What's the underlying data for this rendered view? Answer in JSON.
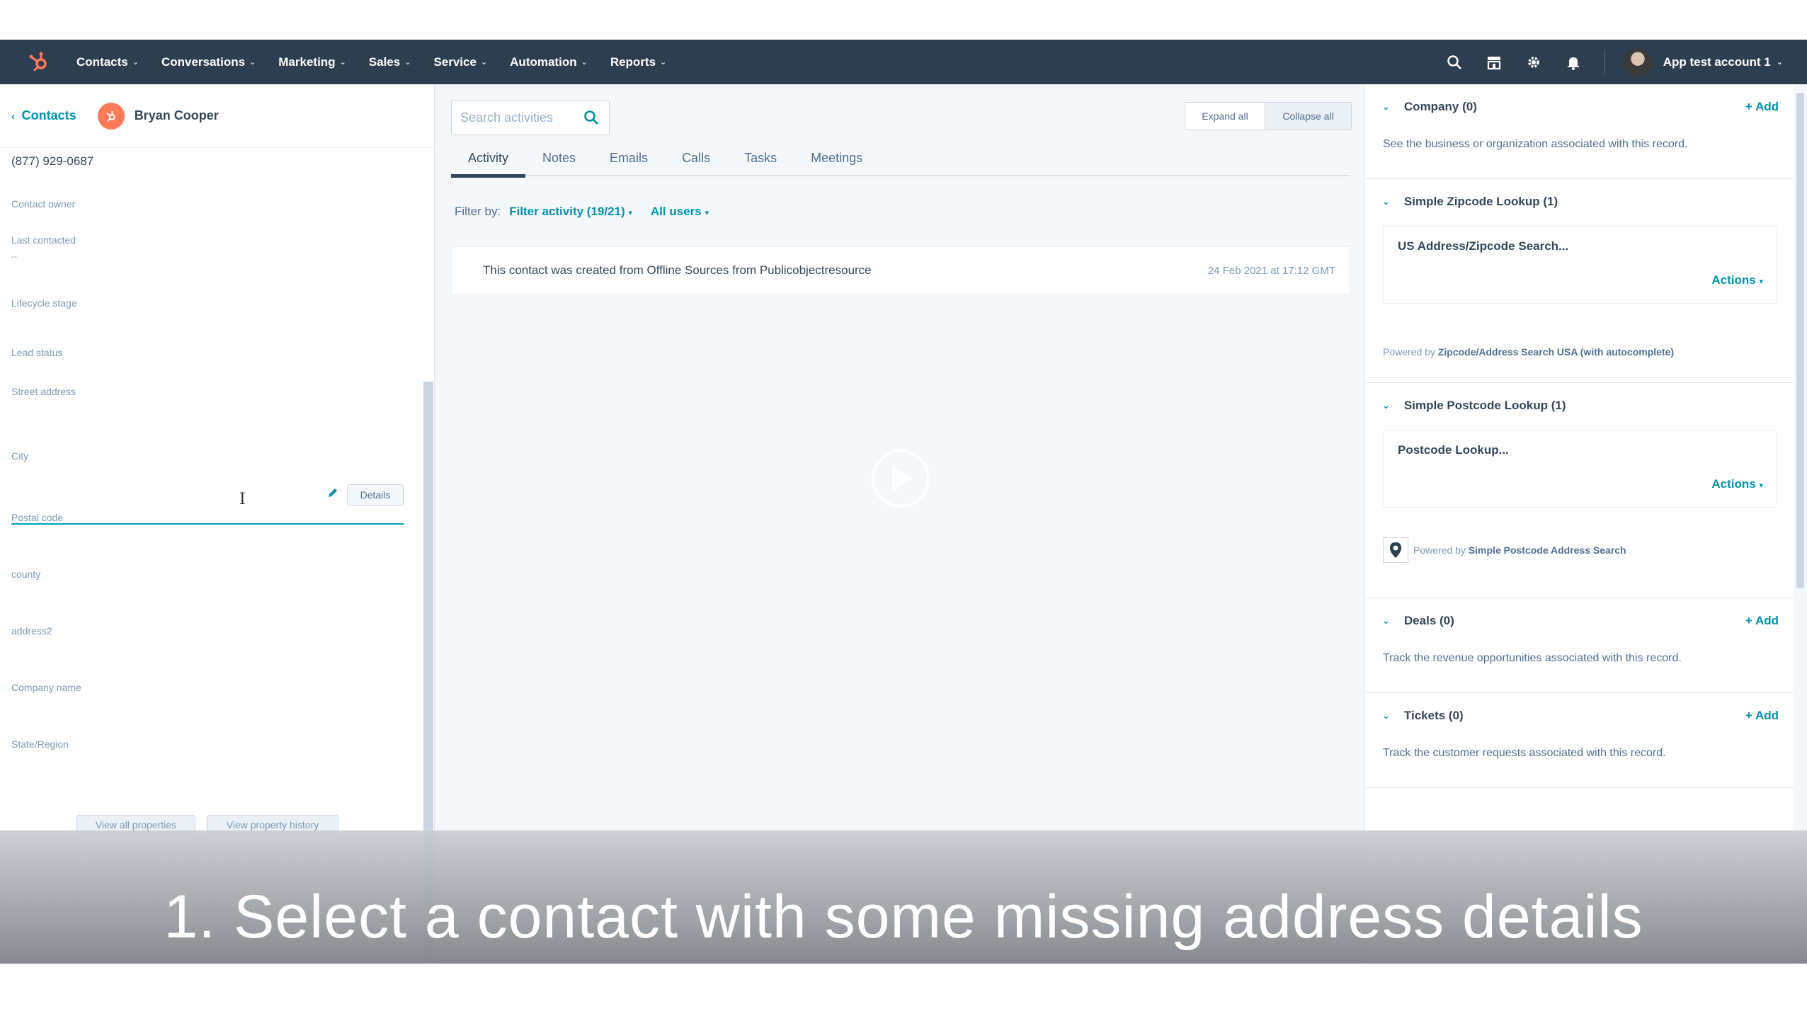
{
  "nav": {
    "items": [
      {
        "label": "Contacts"
      },
      {
        "label": "Conversations"
      },
      {
        "label": "Marketing"
      },
      {
        "label": "Sales"
      },
      {
        "label": "Service"
      },
      {
        "label": "Automation"
      },
      {
        "label": "Reports"
      }
    ],
    "account_label": "App test account 1",
    "icons": [
      "search-icon",
      "marketplace-icon",
      "gear-icon",
      "bell-icon"
    ]
  },
  "left": {
    "back_label": "Contacts",
    "contact_name": "Bryan Cooper",
    "phone": "(877) 929-0687",
    "properties": [
      {
        "label": "Contact owner"
      },
      {
        "label": "Last contacted",
        "value": "--"
      },
      {
        "label": "Lifecycle stage"
      },
      {
        "label": "Lead status"
      },
      {
        "label": "Street address"
      },
      {
        "label": "City"
      },
      {
        "label": "Postal code"
      },
      {
        "label": "county"
      },
      {
        "label": "address2"
      },
      {
        "label": "Company name"
      },
      {
        "label": "State/Region"
      }
    ],
    "details_label": "Details",
    "view_all_label": "View all properties",
    "view_history_label": "View property history"
  },
  "middle": {
    "search_placeholder": "Search activities",
    "expand_all": "Expand all",
    "collapse_all": "Collapse all",
    "tabs": [
      "Activity",
      "Notes",
      "Emails",
      "Calls",
      "Tasks",
      "Meetings"
    ],
    "filter_by": "Filter by:",
    "filter_activity": "Filter activity (19/21)",
    "all_users": "All users",
    "activity_message": "This contact was created from Offline Sources from Publicobjectresource",
    "activity_timestamp": "24 Feb 2021 at 17:12 GMT"
  },
  "right": {
    "company": {
      "title": "Company (0)",
      "add": "+ Add",
      "text": "See the business or organization associated with this record."
    },
    "zipcode": {
      "title": "Simple Zipcode Lookup (1)",
      "card_title": "US Address/Zipcode Search...",
      "actions": "Actions",
      "powered_prefix": "Powered by",
      "powered_name": "Zipcode/Address Search USA (with autocomplete)"
    },
    "postcode": {
      "title": "Simple Postcode Lookup (1)",
      "card_title": "Postcode Lookup...",
      "actions": "Actions",
      "powered_prefix": "Powered by",
      "powered_name": "Simple Postcode Address Search"
    },
    "deals": {
      "title": "Deals (0)",
      "add": "+ Add",
      "text": "Track the revenue opportunities associated with this record."
    },
    "tickets": {
      "title": "Tickets (0)",
      "add": "+ Add",
      "text": "Track the customer requests associated with this record."
    }
  },
  "caption": "1. Select a contact with some missing address details",
  "colors": {
    "nav_bg": "#2d3e50",
    "accent": "#0091ae",
    "brand": "#ff7a59"
  }
}
